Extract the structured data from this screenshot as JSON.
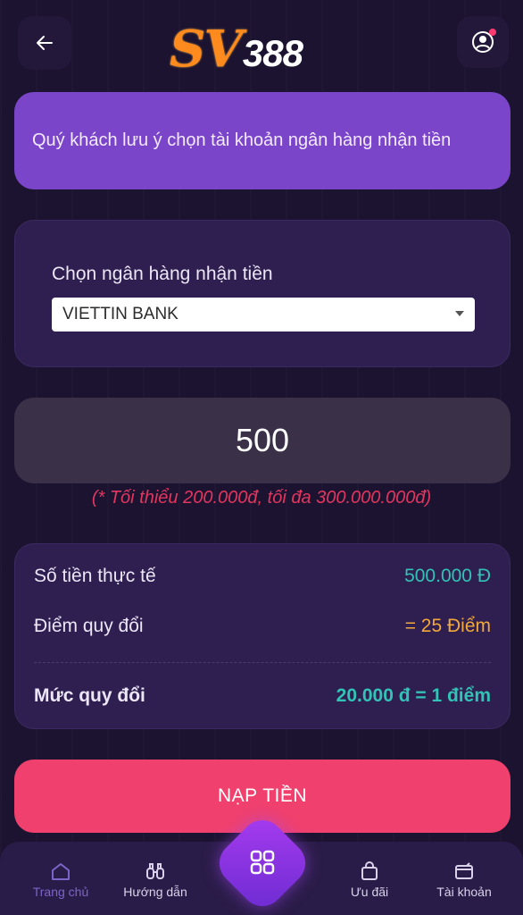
{
  "header": {
    "logo_sv": "SV",
    "logo_num": "388",
    "back_icon": "arrow-left-icon",
    "user_icon": "user-circle-icon"
  },
  "notice": {
    "text": "Quý khách lưu ý chọn tài khoản ngân hàng nhận tiền"
  },
  "bank": {
    "label": "Chọn ngân hàng nhận tiền",
    "selected": "VIETTIN BANK"
  },
  "amount": {
    "value": "500",
    "hint": "(* Tối thiểu 200.000đ, tối đa 300.000.000đ)"
  },
  "summary": {
    "actual_label": "Số tiền thực tế",
    "actual_value": "500.000 Đ",
    "points_label": "Điểm quy đổi",
    "points_value": "= 25 Điểm",
    "rate_label": "Mức quy đổi",
    "rate_value": "20.000 đ = 1 điểm"
  },
  "submit": {
    "label": "NẠP TIỀN"
  },
  "nav": {
    "items": [
      {
        "label": "Trang chủ",
        "icon": "home-icon"
      },
      {
        "label": "Hướng dẫn",
        "icon": "binoculars-icon"
      },
      {
        "label": "",
        "icon": "grid-icon"
      },
      {
        "label": "Ưu đãi",
        "icon": "bag-icon"
      },
      {
        "label": "Tài khoản",
        "icon": "wallet-icon"
      }
    ]
  },
  "colors": {
    "background": "#1c1331",
    "notice": "#7a45c9",
    "card": "#2e1f50",
    "accent_pink": "#f0416e",
    "teal": "#33c2b6",
    "orange": "#f2a93b",
    "hint_red": "#e2365f"
  }
}
